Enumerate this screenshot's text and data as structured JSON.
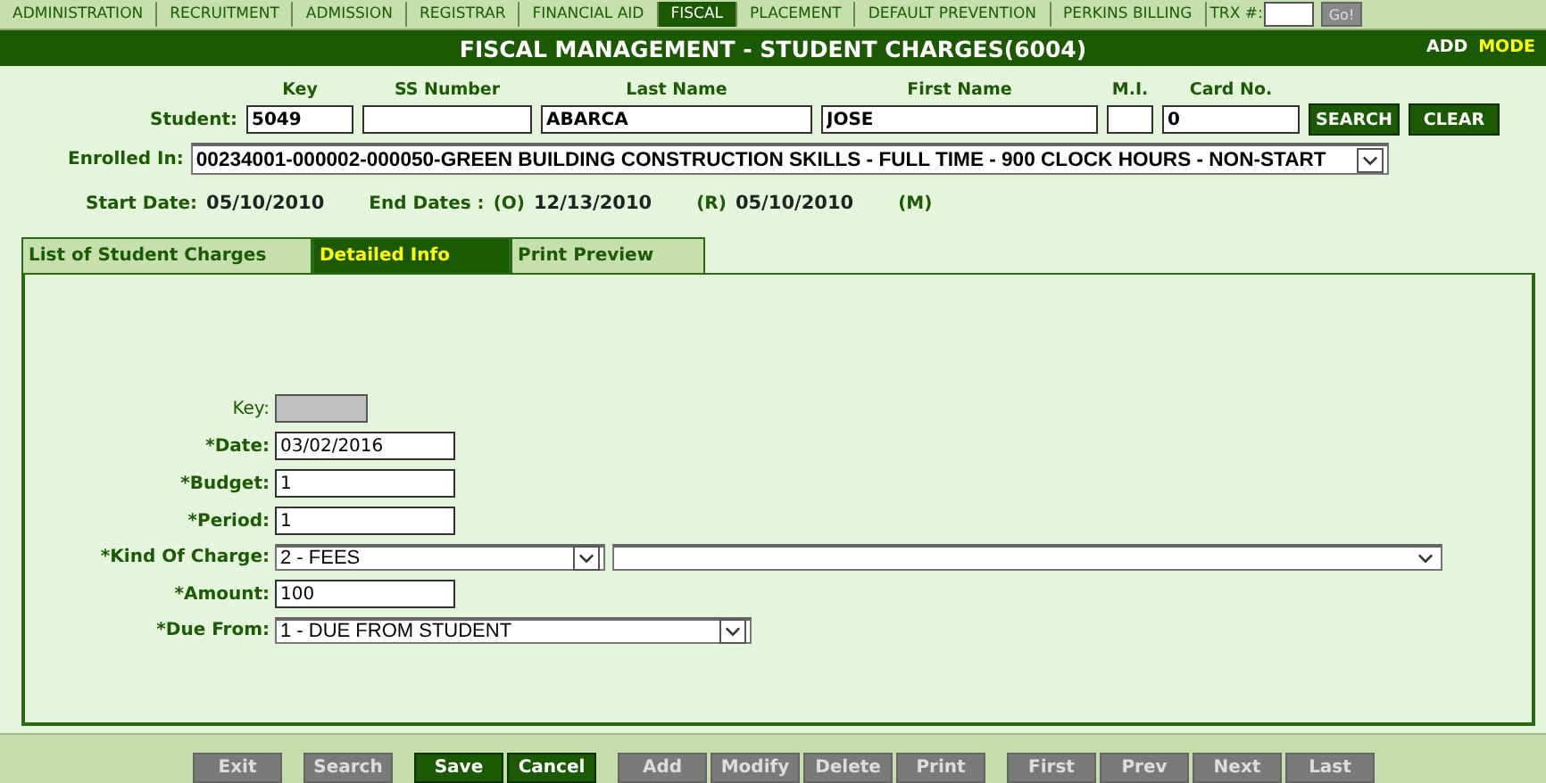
{
  "nav": {
    "tabs": [
      {
        "label": "ADMINISTRATION",
        "selected": false
      },
      {
        "label": "RECRUITMENT",
        "selected": false
      },
      {
        "label": "ADMISSION",
        "selected": false
      },
      {
        "label": "REGISTRAR",
        "selected": false
      },
      {
        "label": "FINANCIAL AID",
        "selected": false
      },
      {
        "label": "FISCAL",
        "selected": true
      },
      {
        "label": "PLACEMENT",
        "selected": false
      },
      {
        "label": "DEFAULT PREVENTION",
        "selected": false
      },
      {
        "label": "PERKINS BILLING",
        "selected": false
      }
    ],
    "trx_label": "TRX #:",
    "go_button": "Go!"
  },
  "title": "FISCAL MANAGEMENT - STUDENT CHARGES(6004)",
  "mode": {
    "value": "ADD",
    "label": "MODE"
  },
  "student": {
    "label": "Student:",
    "fields": [
      {
        "header": "Key",
        "value": "5049"
      },
      {
        "header": "SS Number"
      },
      {
        "header": "Last Name",
        "value": "ABARCA"
      },
      {
        "header": "First Name",
        "value": "JOSE"
      },
      {
        "header": "M.I."
      },
      {
        "header": "Card No.",
        "value": "0"
      }
    ],
    "buttons": [
      "SEARCH",
      "CLEAR"
    ]
  },
  "enrolled": {
    "label": "Enrolled In:",
    "value": "00234001-000002-000050-GREEN BUILDING CONSTRUCTION SKILLS - FULL TIME - 900 CLOCK HOURS - NON-START"
  },
  "dates": {
    "start_label": "Start Date:",
    "start": "05/10/2010",
    "end_label": "End Dates :",
    "original_label": "(O)",
    "original": "12/13/2010",
    "revised_label": "(R)",
    "revised": "05/10/2010",
    "m_label": "(M)"
  },
  "tabs": [
    {
      "label": "List of Student Charges",
      "selected": false
    },
    {
      "label": "Detailed Info",
      "selected": true
    },
    {
      "label": "Print Preview",
      "selected": false
    }
  ],
  "form": [
    {
      "kind": "readonly",
      "label": "Key:"
    },
    {
      "kind": "text",
      "label": "*Date:",
      "value": "03/02/2016"
    },
    {
      "kind": "text",
      "label": "*Budget:",
      "value": "1"
    },
    {
      "kind": "text",
      "label": "*Period:",
      "value": "1"
    },
    {
      "kind": "select2",
      "label": "*Kind Of Charge:",
      "value": "2 - FEES"
    },
    {
      "kind": "text",
      "label": "*Amount:",
      "value": "100"
    },
    {
      "kind": "select",
      "label": "*Due From:",
      "value": "1 - DUE FROM STUDENT"
    }
  ],
  "button_groups": [
    [
      {
        "label": "Exit",
        "disabled": true
      }
    ],
    [
      {
        "label": "Search",
        "disabled": true
      }
    ],
    [
      {
        "label": "Save",
        "disabled": false
      },
      {
        "label": "Cancel",
        "disabled": false
      }
    ],
    [
      {
        "label": "Add",
        "disabled": true
      },
      {
        "label": "Modify",
        "disabled": true
      },
      {
        "label": "Delete",
        "disabled": true
      },
      {
        "label": "Print",
        "disabled": true
      }
    ],
    [
      {
        "label": "First",
        "disabled": true
      },
      {
        "label": "Prev",
        "disabled": true
      },
      {
        "label": "Next",
        "disabled": true
      },
      {
        "label": "Last",
        "disabled": true
      }
    ]
  ]
}
